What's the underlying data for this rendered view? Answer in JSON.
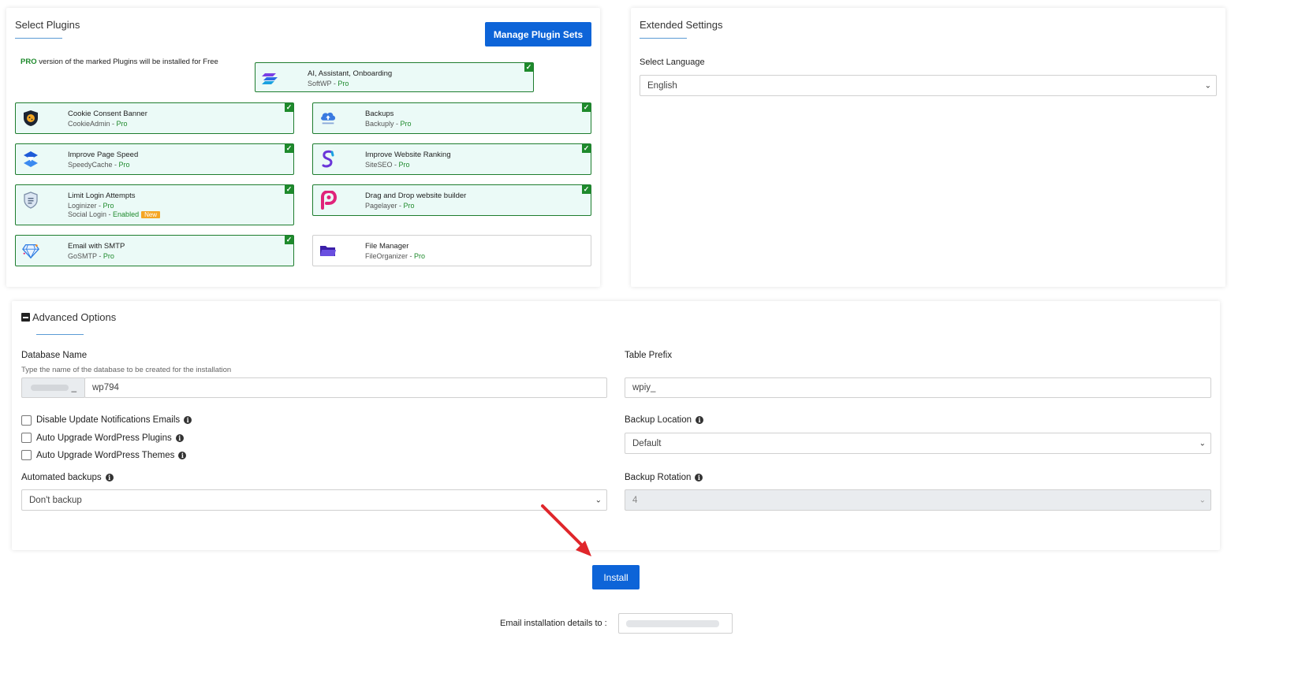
{
  "select_plugins": {
    "title": "Select Plugins",
    "manage_button": "Manage Plugin Sets",
    "pro_note_bold": "PRO",
    "pro_note": "version of the marked Plugins will be installed for Free",
    "plugins": [
      {
        "name": "AI, Assistant, Onboarding",
        "vendor": "SoftWP",
        "pro": "Pro",
        "icon": "softwp-layers-icon",
        "checked": true
      },
      {
        "name": "Cookie Consent Banner",
        "vendor": "CookieAdmin",
        "pro": "Pro",
        "icon": "shield-cookie-icon",
        "checked": true
      },
      {
        "name": "Backups",
        "vendor": "Backuply",
        "pro": "Pro",
        "icon": "cloud-upload-icon",
        "checked": true
      },
      {
        "name": "Improve Page Speed",
        "vendor": "SpeedyCache",
        "pro": "Pro",
        "icon": "speedycache-icon",
        "checked": true
      },
      {
        "name": "Improve Website Ranking",
        "vendor": "SiteSEO",
        "pro": "Pro",
        "icon": "siteseo-icon",
        "checked": true
      },
      {
        "name": "Limit Login Attempts",
        "vendor": "Loginizer",
        "pro": "Pro",
        "extra_label": "Social Login",
        "extra_status": "Enabled",
        "extra_badge": "New",
        "icon": "loginizer-shield-icon",
        "checked": true
      },
      {
        "name": "Drag and Drop website builder",
        "vendor": "Pagelayer",
        "pro": "Pro",
        "icon": "pagelayer-icon",
        "checked": true
      },
      {
        "name": "Email with SMTP",
        "vendor": "GoSMTP",
        "pro": "Pro",
        "icon": "gosmtp-diamond-icon",
        "checked": true
      },
      {
        "name": "File Manager",
        "vendor": "FileOrganizer",
        "pro": "Pro",
        "icon": "folder-icon",
        "checked": false
      }
    ],
    "separator": " - "
  },
  "extended": {
    "title": "Extended Settings",
    "language_label": "Select Language",
    "language_value": "English"
  },
  "advanced": {
    "title": "Advanced Options",
    "db_label": "Database Name",
    "db_hint": "Type the name of the database to be created for the installation",
    "db_prefix": "_",
    "db_value": "wp794",
    "table_prefix_label": "Table Prefix",
    "table_prefix_value": "wpiy_",
    "cb_disable_notifications": "Disable Update Notifications Emails",
    "cb_auto_plugins": "Auto Upgrade WordPress Plugins",
    "cb_auto_themes": "Auto Upgrade WordPress Themes",
    "backup_location_label": "Backup Location",
    "backup_location_value": "Default",
    "automated_backups_label": "Automated backups",
    "automated_backups_value": "Don't backup",
    "backup_rotation_label": "Backup Rotation",
    "backup_rotation_value": "4"
  },
  "install_button": "Install",
  "email_label": "Email installation details to :",
  "colors": {
    "primary": "#0d64d8",
    "pro_green": "#1e8a2c",
    "arrow_red": "#e0262b",
    "checked_bg": "#ebfaf7"
  }
}
